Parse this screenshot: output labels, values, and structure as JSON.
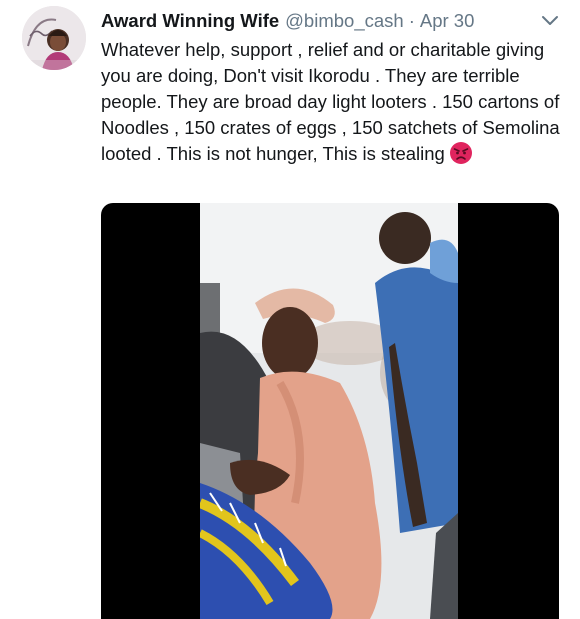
{
  "tweet": {
    "author_name": "Award Winning Wife",
    "handle": "@bimbo_cash",
    "separator": "·",
    "date": "Apr 30",
    "text": "Whatever help, support , relief and or charitable giving you are doing, Don't visit Ikorodu . They are terrible people. They are broad day light looters . 150 cartons of Noodles , 150 crates of eggs , 150 satchets of Semolina looted . This is not hunger, This is stealing",
    "emoji": "angry-face-emoji",
    "caret_icon": "chevron-down-icon"
  },
  "colors": {
    "name": "#14171a",
    "secondary": "#657786",
    "emoji": "#e0245e",
    "media_bg": "#000000"
  }
}
